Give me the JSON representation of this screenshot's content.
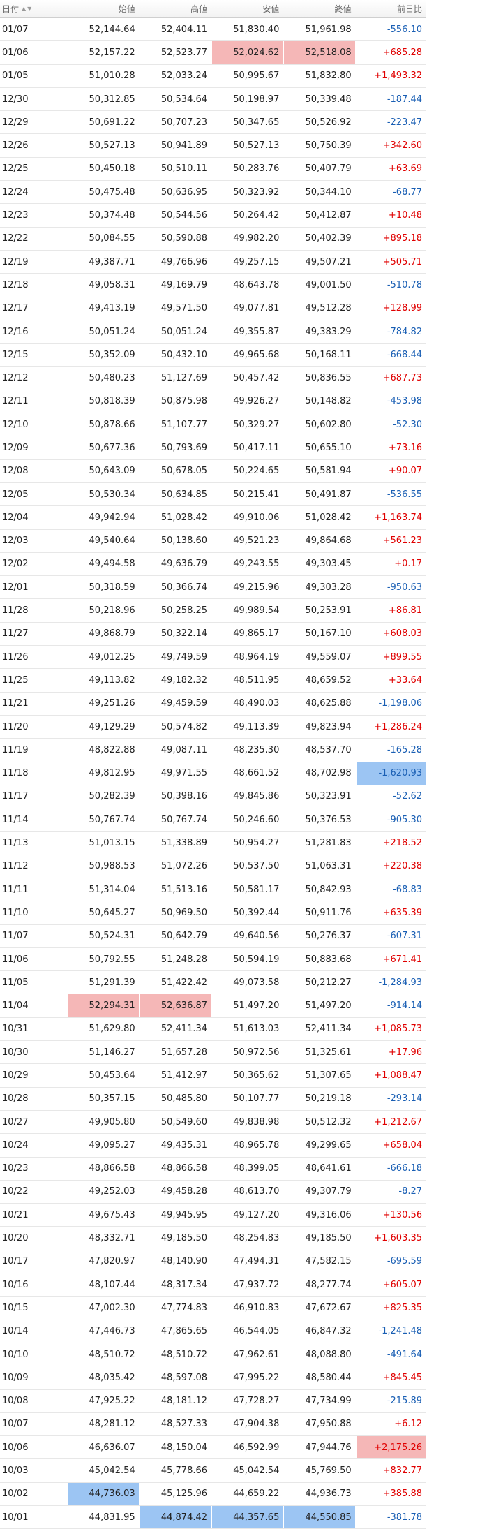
{
  "headers": {
    "date": "日付",
    "open": "始値",
    "high": "高値",
    "low": "安値",
    "close": "終値",
    "change": "前日比"
  },
  "sort_icons": [
    "sort-asc-icon",
    "sort-desc-icon"
  ],
  "colors": {
    "up": "#e00000",
    "down": "#1a5fb4",
    "highlight_high": "#f5b7b7",
    "highlight_low": "#9cc5f3"
  },
  "rows": [
    {
      "date": "01/07",
      "open": "52,144.64",
      "high": "52,404.11",
      "low": "51,830.40",
      "close": "51,961.98",
      "change": "-556.10"
    },
    {
      "date": "01/06",
      "open": "52,157.22",
      "high": "52,523.77",
      "low": "52,024.62",
      "close": "52,518.08",
      "change": "+685.28",
      "hl": {
        "low": "red",
        "close": "red"
      }
    },
    {
      "date": "01/05",
      "open": "51,010.28",
      "high": "52,033.24",
      "low": "50,995.67",
      "close": "51,832.80",
      "change": "+1,493.32"
    },
    {
      "date": "12/30",
      "open": "50,312.85",
      "high": "50,534.64",
      "low": "50,198.97",
      "close": "50,339.48",
      "change": "-187.44"
    },
    {
      "date": "12/29",
      "open": "50,691.22",
      "high": "50,707.23",
      "low": "50,347.65",
      "close": "50,526.92",
      "change": "-223.47"
    },
    {
      "date": "12/26",
      "open": "50,527.13",
      "high": "50,941.89",
      "low": "50,527.13",
      "close": "50,750.39",
      "change": "+342.60"
    },
    {
      "date": "12/25",
      "open": "50,450.18",
      "high": "50,510.11",
      "low": "50,283.76",
      "close": "50,407.79",
      "change": "+63.69"
    },
    {
      "date": "12/24",
      "open": "50,475.48",
      "high": "50,636.95",
      "low": "50,323.92",
      "close": "50,344.10",
      "change": "-68.77"
    },
    {
      "date": "12/23",
      "open": "50,374.48",
      "high": "50,544.56",
      "low": "50,264.42",
      "close": "50,412.87",
      "change": "+10.48"
    },
    {
      "date": "12/22",
      "open": "50,084.55",
      "high": "50,590.88",
      "low": "49,982.20",
      "close": "50,402.39",
      "change": "+895.18"
    },
    {
      "date": "12/19",
      "open": "49,387.71",
      "high": "49,766.96",
      "low": "49,257.15",
      "close": "49,507.21",
      "change": "+505.71"
    },
    {
      "date": "12/18",
      "open": "49,058.31",
      "high": "49,169.79",
      "low": "48,643.78",
      "close": "49,001.50",
      "change": "-510.78"
    },
    {
      "date": "12/17",
      "open": "49,413.19",
      "high": "49,571.50",
      "low": "49,077.81",
      "close": "49,512.28",
      "change": "+128.99"
    },
    {
      "date": "12/16",
      "open": "50,051.24",
      "high": "50,051.24",
      "low": "49,355.87",
      "close": "49,383.29",
      "change": "-784.82"
    },
    {
      "date": "12/15",
      "open": "50,352.09",
      "high": "50,432.10",
      "low": "49,965.68",
      "close": "50,168.11",
      "change": "-668.44"
    },
    {
      "date": "12/12",
      "open": "50,480.23",
      "high": "51,127.69",
      "low": "50,457.42",
      "close": "50,836.55",
      "change": "+687.73"
    },
    {
      "date": "12/11",
      "open": "50,818.39",
      "high": "50,875.98",
      "low": "49,926.27",
      "close": "50,148.82",
      "change": "-453.98"
    },
    {
      "date": "12/10",
      "open": "50,878.66",
      "high": "51,107.77",
      "low": "50,329.27",
      "close": "50,602.80",
      "change": "-52.30"
    },
    {
      "date": "12/09",
      "open": "50,677.36",
      "high": "50,793.69",
      "low": "50,417.11",
      "close": "50,655.10",
      "change": "+73.16"
    },
    {
      "date": "12/08",
      "open": "50,643.09",
      "high": "50,678.05",
      "low": "50,224.65",
      "close": "50,581.94",
      "change": "+90.07"
    },
    {
      "date": "12/05",
      "open": "50,530.34",
      "high": "50,634.85",
      "low": "50,215.41",
      "close": "50,491.87",
      "change": "-536.55"
    },
    {
      "date": "12/04",
      "open": "49,942.94",
      "high": "51,028.42",
      "low": "49,910.06",
      "close": "51,028.42",
      "change": "+1,163.74"
    },
    {
      "date": "12/03",
      "open": "49,540.64",
      "high": "50,138.60",
      "low": "49,521.23",
      "close": "49,864.68",
      "change": "+561.23"
    },
    {
      "date": "12/02",
      "open": "49,494.58",
      "high": "49,636.79",
      "low": "49,243.55",
      "close": "49,303.45",
      "change": "+0.17"
    },
    {
      "date": "12/01",
      "open": "50,318.59",
      "high": "50,366.74",
      "low": "49,215.96",
      "close": "49,303.28",
      "change": "-950.63"
    },
    {
      "date": "11/28",
      "open": "50,218.96",
      "high": "50,258.25",
      "low": "49,989.54",
      "close": "50,253.91",
      "change": "+86.81"
    },
    {
      "date": "11/27",
      "open": "49,868.79",
      "high": "50,322.14",
      "low": "49,865.17",
      "close": "50,167.10",
      "change": "+608.03"
    },
    {
      "date": "11/26",
      "open": "49,012.25",
      "high": "49,749.59",
      "low": "48,964.19",
      "close": "49,559.07",
      "change": "+899.55"
    },
    {
      "date": "11/25",
      "open": "49,113.82",
      "high": "49,182.32",
      "low": "48,511.95",
      "close": "48,659.52",
      "change": "+33.64"
    },
    {
      "date": "11/21",
      "open": "49,251.26",
      "high": "49,459.59",
      "low": "48,490.03",
      "close": "48,625.88",
      "change": "-1,198.06"
    },
    {
      "date": "11/20",
      "open": "49,129.29",
      "high": "50,574.82",
      "low": "49,113.39",
      "close": "49,823.94",
      "change": "+1,286.24"
    },
    {
      "date": "11/19",
      "open": "48,822.88",
      "high": "49,087.11",
      "low": "48,235.30",
      "close": "48,537.70",
      "change": "-165.28"
    },
    {
      "date": "11/18",
      "open": "49,812.95",
      "high": "49,971.55",
      "low": "48,661.52",
      "close": "48,702.98",
      "change": "-1,620.93",
      "hl": {
        "change": "blue"
      }
    },
    {
      "date": "11/17",
      "open": "50,282.39",
      "high": "50,398.16",
      "low": "49,845.86",
      "close": "50,323.91",
      "change": "-52.62"
    },
    {
      "date": "11/14",
      "open": "50,767.74",
      "high": "50,767.74",
      "low": "50,246.60",
      "close": "50,376.53",
      "change": "-905.30"
    },
    {
      "date": "11/13",
      "open": "51,013.15",
      "high": "51,338.89",
      "low": "50,954.27",
      "close": "51,281.83",
      "change": "+218.52"
    },
    {
      "date": "11/12",
      "open": "50,988.53",
      "high": "51,072.26",
      "low": "50,537.50",
      "close": "51,063.31",
      "change": "+220.38"
    },
    {
      "date": "11/11",
      "open": "51,314.04",
      "high": "51,513.16",
      "low": "50,581.17",
      "close": "50,842.93",
      "change": "-68.83"
    },
    {
      "date": "11/10",
      "open": "50,645.27",
      "high": "50,969.50",
      "low": "50,392.44",
      "close": "50,911.76",
      "change": "+635.39"
    },
    {
      "date": "11/07",
      "open": "50,524.31",
      "high": "50,642.79",
      "low": "49,640.56",
      "close": "50,276.37",
      "change": "-607.31"
    },
    {
      "date": "11/06",
      "open": "50,792.55",
      "high": "51,248.28",
      "low": "50,594.19",
      "close": "50,883.68",
      "change": "+671.41"
    },
    {
      "date": "11/05",
      "open": "51,291.39",
      "high": "51,422.42",
      "low": "49,073.58",
      "close": "50,212.27",
      "change": "-1,284.93"
    },
    {
      "date": "11/04",
      "open": "52,294.31",
      "high": "52,636.87",
      "low": "51,497.20",
      "close": "51,497.20",
      "change": "-914.14",
      "hl": {
        "open": "red",
        "high": "red"
      }
    },
    {
      "date": "10/31",
      "open": "51,629.80",
      "high": "52,411.34",
      "low": "51,613.03",
      "close": "52,411.34",
      "change": "+1,085.73"
    },
    {
      "date": "10/30",
      "open": "51,146.27",
      "high": "51,657.28",
      "low": "50,972.56",
      "close": "51,325.61",
      "change": "+17.96"
    },
    {
      "date": "10/29",
      "open": "50,453.64",
      "high": "51,412.97",
      "low": "50,365.62",
      "close": "51,307.65",
      "change": "+1,088.47"
    },
    {
      "date": "10/28",
      "open": "50,357.15",
      "high": "50,485.80",
      "low": "50,107.77",
      "close": "50,219.18",
      "change": "-293.14"
    },
    {
      "date": "10/27",
      "open": "49,905.80",
      "high": "50,549.60",
      "low": "49,838.98",
      "close": "50,512.32",
      "change": "+1,212.67"
    },
    {
      "date": "10/24",
      "open": "49,095.27",
      "high": "49,435.31",
      "low": "48,965.78",
      "close": "49,299.65",
      "change": "+658.04"
    },
    {
      "date": "10/23",
      "open": "48,866.58",
      "high": "48,866.58",
      "low": "48,399.05",
      "close": "48,641.61",
      "change": "-666.18"
    },
    {
      "date": "10/22",
      "open": "49,252.03",
      "high": "49,458.28",
      "low": "48,613.70",
      "close": "49,307.79",
      "change": "-8.27"
    },
    {
      "date": "10/21",
      "open": "49,675.43",
      "high": "49,945.95",
      "low": "49,127.20",
      "close": "49,316.06",
      "change": "+130.56"
    },
    {
      "date": "10/20",
      "open": "48,332.71",
      "high": "49,185.50",
      "low": "48,254.83",
      "close": "49,185.50",
      "change": "+1,603.35"
    },
    {
      "date": "10/17",
      "open": "47,820.97",
      "high": "48,140.90",
      "low": "47,494.31",
      "close": "47,582.15",
      "change": "-695.59"
    },
    {
      "date": "10/16",
      "open": "48,107.44",
      "high": "48,317.34",
      "low": "47,937.72",
      "close": "48,277.74",
      "change": "+605.07"
    },
    {
      "date": "10/15",
      "open": "47,002.30",
      "high": "47,774.83",
      "low": "46,910.83",
      "close": "47,672.67",
      "change": "+825.35"
    },
    {
      "date": "10/14",
      "open": "47,446.73",
      "high": "47,865.65",
      "low": "46,544.05",
      "close": "46,847.32",
      "change": "-1,241.48"
    },
    {
      "date": "10/10",
      "open": "48,510.72",
      "high": "48,510.72",
      "low": "47,962.61",
      "close": "48,088.80",
      "change": "-491.64"
    },
    {
      "date": "10/09",
      "open": "48,035.42",
      "high": "48,597.08",
      "low": "47,995.22",
      "close": "48,580.44",
      "change": "+845.45"
    },
    {
      "date": "10/08",
      "open": "47,925.22",
      "high": "48,181.12",
      "low": "47,728.27",
      "close": "47,734.99",
      "change": "-215.89"
    },
    {
      "date": "10/07",
      "open": "48,281.12",
      "high": "48,527.33",
      "low": "47,904.38",
      "close": "47,950.88",
      "change": "+6.12"
    },
    {
      "date": "10/06",
      "open": "46,636.07",
      "high": "48,150.04",
      "low": "46,592.99",
      "close": "47,944.76",
      "change": "+2,175.26",
      "hl": {
        "change": "red"
      }
    },
    {
      "date": "10/03",
      "open": "45,042.54",
      "high": "45,778.66",
      "low": "45,042.54",
      "close": "45,769.50",
      "change": "+832.77"
    },
    {
      "date": "10/02",
      "open": "44,736.03",
      "high": "45,125.96",
      "low": "44,659.22",
      "close": "44,936.73",
      "change": "+385.88",
      "hl": {
        "open": "blue"
      }
    },
    {
      "date": "10/01",
      "open": "44,831.95",
      "high": "44,874.42",
      "low": "44,357.65",
      "close": "44,550.85",
      "change": "-381.78",
      "hl": {
        "high": "blue",
        "low": "blue",
        "close": "blue"
      }
    }
  ]
}
